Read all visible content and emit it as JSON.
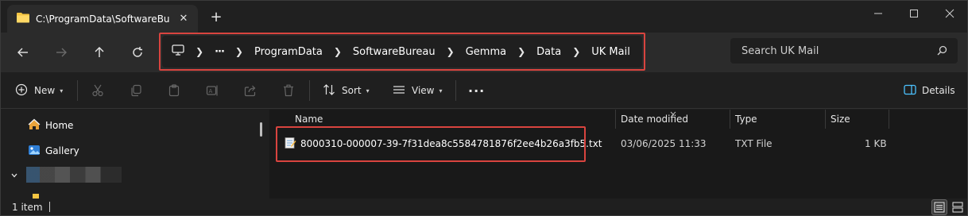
{
  "window": {
    "tab_title": "C:\\ProgramData\\SoftwareBure",
    "tab_icon": "folder-icon",
    "new_tab_label": "+"
  },
  "address": {
    "crumbs": [
      "ProgramData",
      "SoftwareBureau",
      "Gemma",
      "Data",
      "UK Mail"
    ],
    "ellipsis": "···",
    "highlight_color": "#d9443f"
  },
  "search": {
    "placeholder": "Search UK Mail"
  },
  "toolbar": {
    "new_label": "New",
    "sort_label": "Sort",
    "view_label": "View",
    "more_label": "···",
    "details_label": "Details"
  },
  "nav": {
    "items": [
      {
        "label": "Home",
        "icon": "home-icon"
      },
      {
        "label": "Gallery",
        "icon": "gallery-icon"
      }
    ]
  },
  "columns": {
    "name": "Name",
    "date": "Date modified",
    "type": "Type",
    "size": "Size"
  },
  "files": [
    {
      "name": "8000310-000007-39-7f31dea8c5584781876f2ee4b26a3fb5.txt",
      "date": "03/06/2025 11:33",
      "type": "TXT File",
      "size": "1 KB",
      "icon": "text-file-icon"
    }
  ],
  "status": {
    "item_count": "1 item"
  },
  "colors": {
    "accent": "#4cc2ff",
    "highlight": "#d9443f",
    "folder": "#f4c542"
  }
}
